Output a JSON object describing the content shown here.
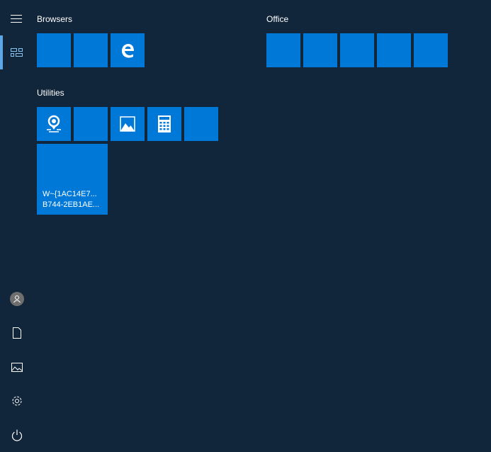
{
  "groups": {
    "browsers": "Browsers",
    "utilities": "Utilities",
    "office": "Office"
  },
  "big_tile": {
    "line1": "W~{1AC14E7...",
    "line2": "B744-2EB1AE..."
  },
  "colors": {
    "background": "#12263b",
    "tile": "#0078d7",
    "accent": "#5ea7e6"
  }
}
